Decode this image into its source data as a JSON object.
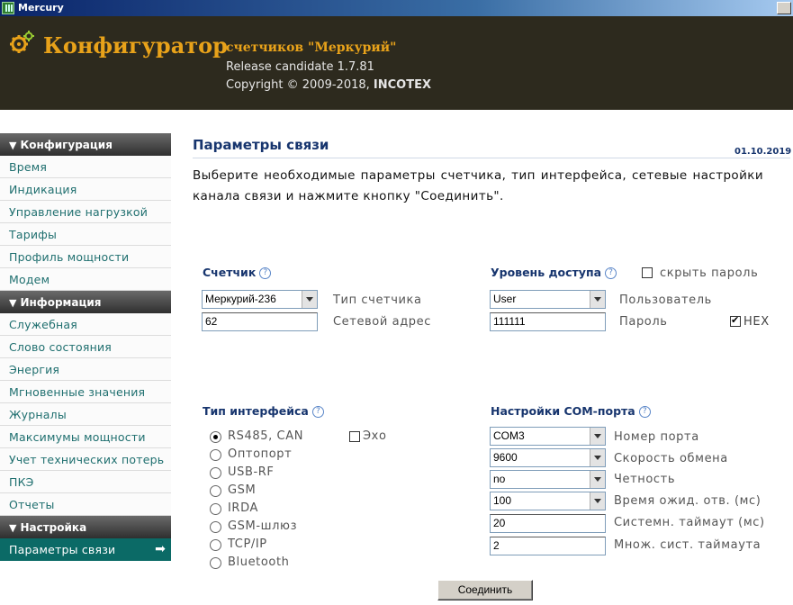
{
  "window": {
    "title": "Mercury"
  },
  "header": {
    "brand": "Конфигуратор",
    "subtitle": "счетчиков \"Меркурий\"",
    "version": "Release candidate 1.7.81",
    "copyright_prefix": "Copyright © 2009-2018, ",
    "copyright_company": "INCOTEX"
  },
  "sidebar": {
    "sections": [
      {
        "title": "Конфигурация",
        "items": [
          "Время",
          "Индикация",
          "Управление нагрузкой",
          "Тарифы",
          "Профиль мощности",
          "Модем"
        ]
      },
      {
        "title": "Информация",
        "items": [
          "Служебная",
          "Слово состояния",
          "Энергия",
          "Мгновенные значения",
          "Журналы",
          "Максимумы мощности",
          "Учет технических потерь",
          "ПКЭ",
          "Отчеты"
        ]
      },
      {
        "title": "Настройка",
        "items": [
          "Параметры связи"
        ]
      }
    ],
    "active_item": "Параметры связи"
  },
  "main": {
    "title": "Параметры связи",
    "date": "01.10.2019",
    "intro": "Выберите необходимые параметры счетчика, тип интерфейса, сетевые настройки канала связи и нажмите кнопку \"Соединить\".",
    "meter": {
      "title": "Счетчик",
      "type_value": "Меркурий-236",
      "type_label": "Тип счетчика",
      "address_value": "62",
      "address_label": "Сетевой адрес"
    },
    "access": {
      "title": "Уровень доступа",
      "hide_password_label": "скрыть пароль",
      "hide_password_checked": false,
      "level_value": "User",
      "level_label": "Пользователь",
      "password_value": "111111",
      "password_label": "Пароль",
      "hex_label": "HEX",
      "hex_checked": true
    },
    "interface": {
      "title": "Тип интерфейса",
      "echo_label": "Эхо",
      "echo_checked": false,
      "options": [
        "RS485, CAN",
        "Оптопорт",
        "USB-RF",
        "GSM",
        "IRDA",
        "GSM-шлюз",
        "TCP/IP",
        "Bluetooth"
      ],
      "selected": "RS485, CAN"
    },
    "com": {
      "title": "Настройки COM-порта",
      "port_value": "COM3",
      "port_label": "Номер порта",
      "speed_value": "9600",
      "speed_label": "Скорость обмена",
      "parity_value": "no",
      "parity_label": "Четность",
      "wait_value": "100",
      "wait_label": "Время ожид. отв. (мс)",
      "sys_timeout_value": "20",
      "sys_timeout_label": "Системн. таймаут (мс)",
      "mult_value": "2",
      "mult_label": "Множ. сист. таймаута"
    },
    "connect_label": "Соединить"
  },
  "colors": {
    "header_bg": "#2d2a1e",
    "brand": "#e8a21a",
    "heading": "#17356e",
    "link": "#1f6f6f",
    "active_bg": "#0b6a66"
  },
  "icons": [
    "mercury-app-icon",
    "gear-icon",
    "help-icon",
    "arrow-right-icon",
    "triangle-down-icon"
  ]
}
